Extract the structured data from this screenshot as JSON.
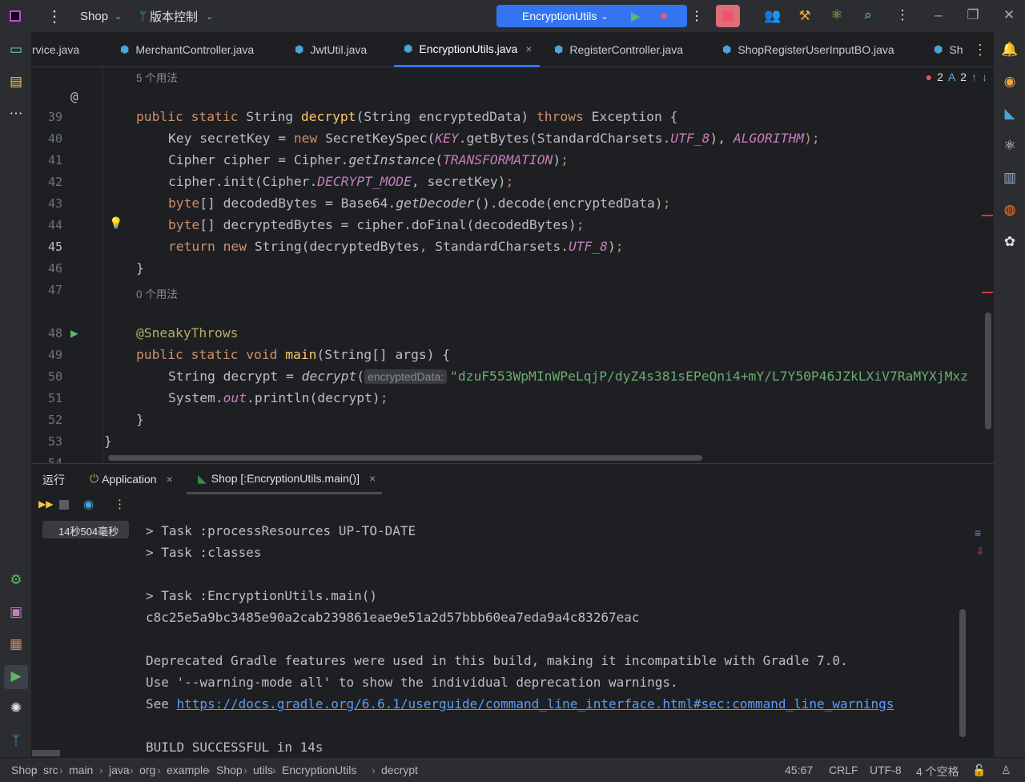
{
  "titlebar": {
    "project": "Shop",
    "vcs": "版本控制",
    "run_config": "EncryptionUtils"
  },
  "tabs": [
    {
      "label": "rvice.java"
    },
    {
      "label": "MerchantController.java"
    },
    {
      "label": "JwtUtil.java"
    },
    {
      "label": "EncryptionUtils.java",
      "active": true
    },
    {
      "label": "RegisterController.java"
    },
    {
      "label": "ShopRegisterUserInputBO.java"
    },
    {
      "label": "Sh"
    }
  ],
  "inspections": {
    "errors": "2",
    "warnings": "2"
  },
  "editor": {
    "hints": [
      {
        "before": 39,
        "text": "5 个用法"
      },
      {
        "before": 48,
        "text": "0 个用法"
      }
    ],
    "lines": [
      {
        "n": "39",
        "indent": 1,
        "t": [
          [
            "k",
            "public static "
          ],
          [
            "",
            "String "
          ],
          [
            "f",
            "decrypt"
          ],
          [
            "",
            "(String encryptedData) "
          ],
          [
            "k",
            "throws "
          ],
          [
            "",
            "Exception {"
          ]
        ]
      },
      {
        "n": "40",
        "indent": 2,
        "t": [
          [
            "",
            "Key secretKey = "
          ],
          [
            "k",
            "new "
          ],
          [
            "",
            "SecretKeySpec("
          ],
          [
            "st",
            "KEY"
          ],
          [
            "",
            ".getBytes(StandardCharsets."
          ],
          [
            "st",
            "UTF_8"
          ],
          [
            "",
            "), "
          ],
          [
            "st",
            "ALGORITHM"
          ],
          [
            "k",
            ");"
          ]
        ]
      },
      {
        "n": "41",
        "indent": 2,
        "t": [
          [
            "",
            "Cipher cipher = Cipher."
          ],
          [
            "it",
            "getInstance"
          ],
          [
            "",
            "("
          ],
          [
            "st",
            "TRANSFORMATION"
          ],
          [
            "",
            ")"
          ],
          [
            "k",
            ";"
          ]
        ]
      },
      {
        "n": "42",
        "indent": 2,
        "t": [
          [
            "",
            "cipher.init(Cipher."
          ],
          [
            "st",
            "DECRYPT_MODE"
          ],
          [
            "",
            ", secretKey)"
          ],
          [
            "k",
            ";"
          ]
        ]
      },
      {
        "n": "43",
        "indent": 2,
        "t": [
          [
            "k",
            "byte"
          ],
          [
            "",
            "[] decodedBytes = Base64."
          ],
          [
            "it",
            "getDecoder"
          ],
          [
            "",
            "().decode(encryptedData)"
          ],
          [
            "k",
            ";"
          ]
        ]
      },
      {
        "n": "44",
        "indent": 2,
        "t": [
          [
            "k",
            "byte"
          ],
          [
            "",
            "[] decryptedBytes = cipher.doFinal(decodedBytes)"
          ],
          [
            "k",
            ";"
          ]
        ]
      },
      {
        "n": "45",
        "indent": 2,
        "t": [
          [
            "k",
            "return new "
          ],
          [
            "",
            "String(decryptedBytes"
          ],
          [
            "k",
            ", "
          ],
          [
            "",
            "StandardCharsets."
          ],
          [
            "st",
            "UTF_8"
          ],
          [
            "",
            ")"
          ],
          [
            "k",
            ";"
          ]
        ]
      },
      {
        "n": "46",
        "indent": 1,
        "t": [
          [
            "",
            "}"
          ]
        ]
      },
      {
        "n": "47",
        "indent": 0,
        "t": []
      },
      {
        "n": "48",
        "indent": 1,
        "t": [
          [
            "an",
            "@SneakyThrows"
          ]
        ]
      },
      {
        "n": "49",
        "indent": 1,
        "t": [
          [
            "k",
            "public static void "
          ],
          [
            "f",
            "main"
          ],
          [
            "",
            "(String[] args) {"
          ]
        ]
      },
      {
        "n": "50",
        "indent": 2,
        "t": [
          [
            "",
            "String decrypt = "
          ],
          [
            "it",
            "decrypt"
          ],
          [
            "",
            "("
          ],
          [
            "inl",
            "encryptedData:"
          ],
          [
            "s",
            "\"dzuF553WpMInWPeLqjP/dyZ4s381sEPeQni4+mY/L7Y50P46JZkLXiV7RaMYXjMxz"
          ]
        ]
      },
      {
        "n": "51",
        "indent": 2,
        "t": [
          [
            "",
            "System."
          ],
          [
            "st",
            "out"
          ],
          [
            "",
            ".println(decrypt)"
          ],
          [
            "k",
            ";"
          ]
        ]
      },
      {
        "n": "52",
        "indent": 1,
        "t": [
          [
            "",
            "}"
          ]
        ]
      },
      {
        "n": "53",
        "indent": 0,
        "t": [
          [
            "",
            "}"
          ]
        ]
      },
      {
        "n": "54",
        "indent": 0,
        "t": []
      }
    ]
  },
  "run_panel": {
    "title": "运行",
    "tabs": [
      {
        "label": "Application"
      },
      {
        "label": "Shop [:EncryptionUtils.main()]"
      }
    ],
    "run_item": "14秒504毫秒",
    "console": [
      "> Task :processResources UP-TO-DATE",
      "> Task :classes",
      "",
      "> Task :EncryptionUtils.main()",
      "c8c25e5a9bc3485e90a2cab239861eae9e51a2d57bbb60ea7eda9a4c83267eac",
      "",
      "Deprecated Gradle features were used in this build, making it incompatible with Gradle 7.0.",
      "Use '--warning-mode all' to show the individual deprecation warnings.",
      "See ",
      "",
      "BUILD SUCCESSFUL in 14s"
    ],
    "link": "https://docs.gradle.org/6.6.1/userguide/command_line_interface.html#sec:command_line_warnings"
  },
  "statusbar": {
    "breadcrumbs": [
      "Shop",
      "src",
      "main",
      "java",
      "org",
      "example",
      "Shop",
      "utils",
      "EncryptionUtils",
      "decrypt"
    ],
    "position": "45:67",
    "line_sep": "CRLF",
    "encoding": "UTF-8",
    "indent": "4 个空格"
  },
  "colors": {
    "accent": "#3574f0",
    "keyword": "#cf8e6d",
    "string": "#6aab73",
    "static": "#c77dbb"
  }
}
